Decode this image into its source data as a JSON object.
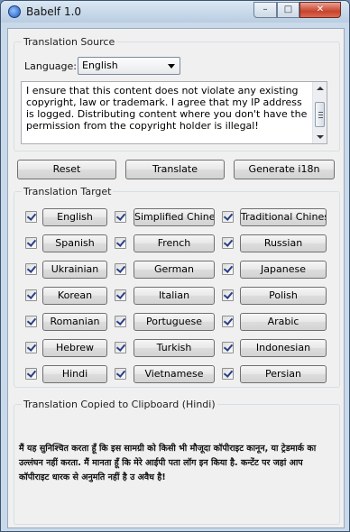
{
  "window": {
    "title": "Babelf 1.0",
    "controls": {
      "minimize": "–",
      "maximize": "□",
      "close": "✕"
    }
  },
  "source": {
    "group_title": "Translation Source",
    "language_label": "Language:",
    "language_value": "English",
    "text": "I ensure that this content does not violate any existing copyright, law or trademark. I agree that my IP address is logged. Distributing content where you don't have the permission from the copyright holder is illegal!"
  },
  "actions": {
    "reset": "Reset",
    "translate": "Translate",
    "generate": "Generate i18n"
  },
  "target": {
    "group_title": "Translation Target",
    "languages": [
      "English",
      "Simplified Chinese",
      "Traditional Chinese",
      "Spanish",
      "French",
      "Russian",
      "Ukrainian",
      "German",
      "Japanese",
      "Korean",
      "Italian",
      "Polish",
      "Romanian",
      "Portuguese",
      "Arabic",
      "Hebrew",
      "Turkish",
      "Indonesian",
      "Hindi",
      "Vietnamese",
      "Persian"
    ],
    "all_checked": true
  },
  "output": {
    "group_title": "Translation Copied to Clipboard (Hindi)",
    "text": "मैं यह सुनिश्चित करता हूँ कि इस सामग्री को किसी भी मौजूदा कॉपीराइट कानून, या ट्रेडमार्क का उल्लंघन नहीं करता. मैं मानता हूँ कि मेरे आईपी पता लॉग इन किया है. कन्टेंट पर जहां आप कॉपीराइट धारक से अनुमति नहीं है उ अवैध है!"
  },
  "colors": {
    "window_frame": "#c9d9ea",
    "client_bg": "#f0f0f0",
    "close_button": "#c7432c",
    "checkmark": "#2a3f86"
  }
}
